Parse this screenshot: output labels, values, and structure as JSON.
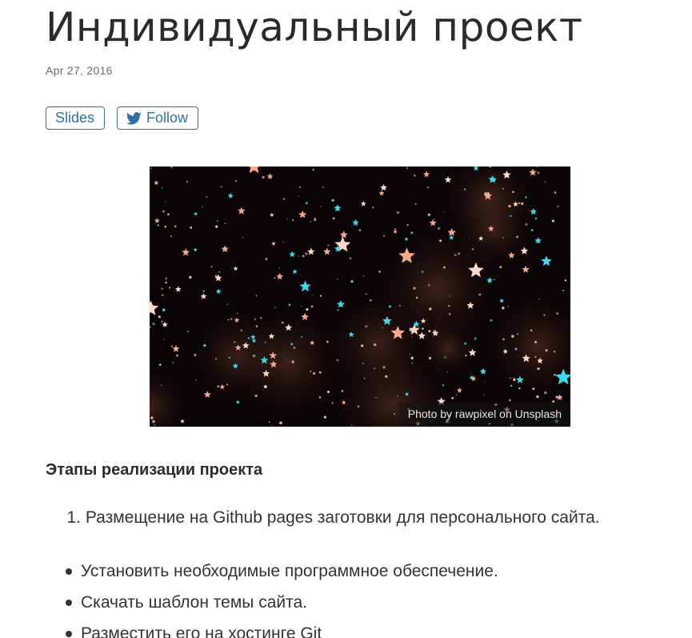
{
  "post": {
    "title": "Индивидуальный проект",
    "date": "Apr 27, 2016"
  },
  "actions": {
    "slides_label": "Slides",
    "follow_label": "Follow",
    "follow_icon": "twitter-icon",
    "accent_color": "#2f6ea8"
  },
  "hero": {
    "caption": "Photo by rawpixel on Unsplash"
  },
  "content": {
    "section_title": "Этапы реализации проекта",
    "ordered": [
      {
        "number": "1.",
        "text": "Размещение на Github pages заготовки для персонального сайта."
      }
    ],
    "bullets": [
      "Установить необходимые программное обеспечение.",
      "Скачать шаблон темы сайта.",
      "Разместить его на хостинге Git"
    ]
  }
}
